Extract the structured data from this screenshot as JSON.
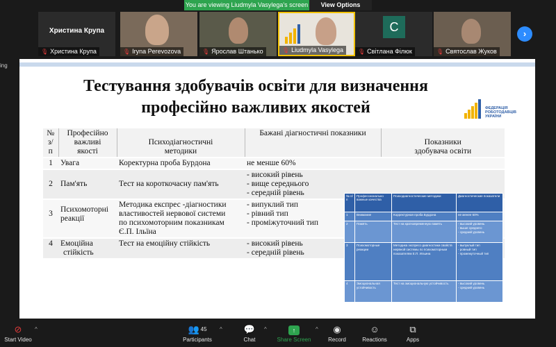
{
  "banner": {
    "message": "You are viewing Liudmyla Vasylega's screen",
    "options": "View Options"
  },
  "participants_strip": [
    {
      "big_name": "Христина Крупа",
      "name": "Христина Крупа"
    },
    {
      "name": "Iryna Perevozova"
    },
    {
      "name": "Ярослав Штанько"
    },
    {
      "name": "Liudmyla Vasylega"
    },
    {
      "name": "Світлана Філюк",
      "avatar_letter": "С"
    },
    {
      "name": "Святослав Жуков"
    }
  ],
  "side_label": "ing",
  "slide": {
    "title_line1": "Тестування здобувачів освіти для визначення",
    "title_line2": "професійно важливих якостей",
    "logo_text": [
      "ФЕДЕРАЦІЯ",
      "РОБОТОДАВЦІВ",
      "УКРАЇНИ"
    ],
    "table": {
      "headers": {
        "num": [
          "№",
          "з/",
          "п"
        ],
        "quality": [
          "Професійно",
          "важливі",
          "якості"
        ],
        "methods": [
          "Психодіагностичні",
          "методики"
        ],
        "desired": "Бажані діагностичні показники",
        "student": [
          "Показники",
          "здобувача освіти"
        ]
      },
      "rows": [
        {
          "num": "1",
          "quality": [
            "Увага"
          ],
          "method": [
            "Коректурна проба Бурдона"
          ],
          "desired": [
            "не менше 60%"
          ]
        },
        {
          "num": "2",
          "quality": [
            "Пам'ять"
          ],
          "method": [
            "Тест на короткочасну пам'ять"
          ],
          "desired": [
            "- високий рівень",
            "- вище середнього",
            "- середній рівень"
          ]
        },
        {
          "num": "3",
          "quality": [
            "Психомоторні",
            "реакції"
          ],
          "method": [
            "Методика експрес -діагностики",
            "властивостей нервової системи",
            "по психомоторним показникам",
            "Є.П. Ільїна"
          ],
          "desired": [
            "- випуклий тип",
            "- рівний тип",
            "- проміжуточний тип"
          ]
        },
        {
          "num": "4",
          "quality": [
            "Емоційна",
            "стійкість"
          ],
          "method": [
            "Тест на емоційну стійкість"
          ],
          "desired": [
            "- високий рівень",
            "- середній рівень"
          ]
        }
      ]
    },
    "overlay_table": {
      "headers": [
        "№ п/п",
        "Профессионально важные качества",
        "Психодиагностические методики",
        "Диагностические показатели"
      ],
      "rows": [
        [
          "1",
          "Внимание",
          "Корректурная проба Бурдона",
          "не менее 60%"
        ],
        [
          "2",
          "Память",
          "Тест на кратковременную память",
          "- высокий уровень\n- выше среднего\n- средний уровень"
        ],
        [
          "3",
          "Психомоторные реакции",
          "Методика экспресс-диагностики свойств нервной системы по психомоторным показателям Е.П. Ильина",
          "- выпуклый тип\n- ровный тип\n- промежуточный тип"
        ],
        [
          "4",
          "Эмоциональная устойчивость",
          "Тест на эмоциональную устойчивость",
          "- высокий уровень\n- средний уровень"
        ]
      ]
    }
  },
  "toolbar": {
    "start_video": "Start Video",
    "participants": "Participants",
    "participants_count": "45",
    "chat": "Chat",
    "share_screen": "Share Screen",
    "record": "Record",
    "reactions": "Reactions",
    "apps": "Apps"
  }
}
